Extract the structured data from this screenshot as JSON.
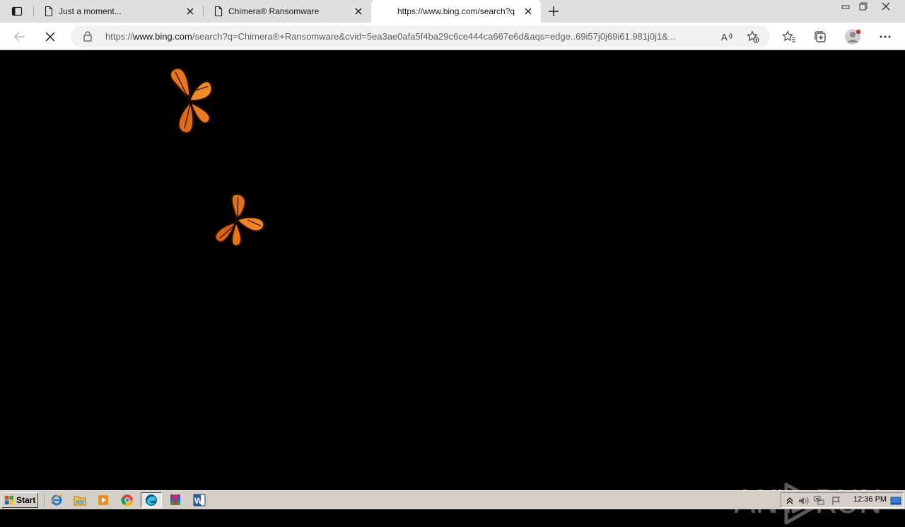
{
  "browser": {
    "tabs": [
      {
        "title": "Just a moment...",
        "active": false
      },
      {
        "title": "Chimera® Ransomware",
        "active": false
      },
      {
        "title": "https://www.bing.com/search?q",
        "active": true
      }
    ],
    "url_prefix": "https://",
    "url_domain": "www.bing.com",
    "url_rest": "/search?q=Chimera®+Ransomware&cvid=5ea3ae0afa5f4ba29c6ce444ca667e6d&aqs=edge..69i57j0j69i61.981j0j1&...",
    "icons": {
      "tab_actions": "tab-actions-icon",
      "back": "back-arrow-icon",
      "stop": "stop-x-icon",
      "lock": "lock-icon",
      "read_aloud": "read-aloud-icon",
      "add_favorite": "add-favorite-icon",
      "favorites": "favorites-icon",
      "collections": "collections-icon",
      "profile": "profile-icon",
      "more": "more-icon"
    }
  },
  "content": {
    "watermark_left": "ANY",
    "watermark_right": "RUN",
    "background": "#000000"
  },
  "taskbar": {
    "start_label": "Start",
    "apps": [
      "internet-explorer-icon",
      "file-explorer-icon",
      "media-player-icon",
      "chrome-icon",
      "edge-icon",
      "winrar-icon",
      "word-icon"
    ],
    "clock": "12:36 PM"
  }
}
